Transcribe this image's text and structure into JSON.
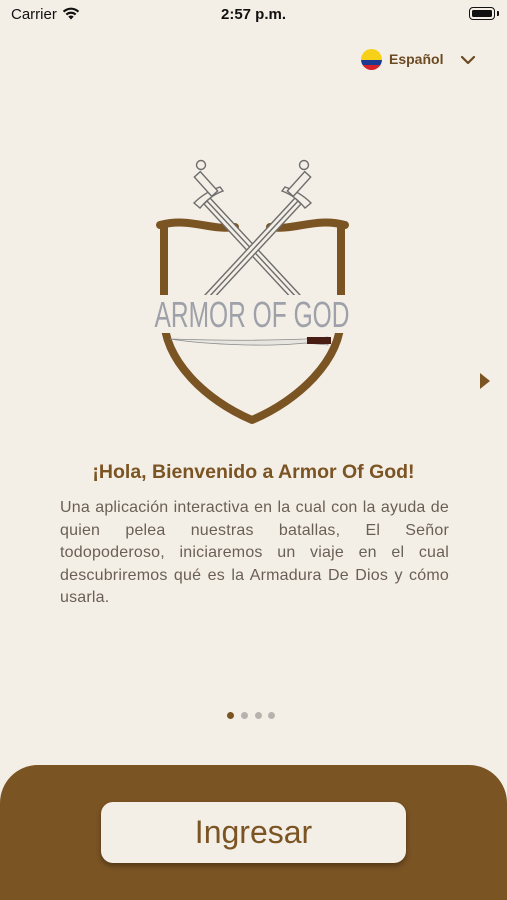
{
  "status_bar": {
    "carrier": "Carrier",
    "time": "2:57 p.m.",
    "battery_level": 1.0
  },
  "language": {
    "label": "Español",
    "flag_icon": "colombia-flag-icon",
    "flag_colors": [
      "#f7d117",
      "#1d3a91",
      "#d6202b"
    ]
  },
  "logo": {
    "text": "ARMOR OF GOD"
  },
  "welcome": {
    "title": "¡Hola, Bienvenido a Armor Of God!",
    "description": "Una aplicación interactiva en la cual con la ayuda de quien pelea nuestras batallas, El Señor todopoderoso, iniciaremos un viaje en el cual descubriremos qué es la Armadura De Dios y cómo usarla."
  },
  "pager": {
    "count": 4,
    "active_index": 0
  },
  "action": {
    "enter_label": "Ingresar"
  },
  "colors": {
    "background": "#f4efe6",
    "brand_brown": "#7b5424",
    "text": "#6a5f56"
  }
}
